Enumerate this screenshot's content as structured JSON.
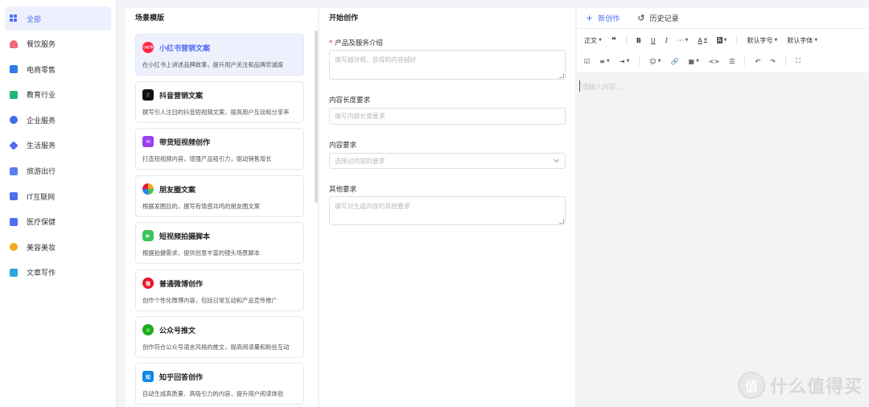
{
  "sidebar": {
    "items": [
      {
        "label": "全部",
        "color": "#4e6ef2"
      },
      {
        "label": "餐饮服务",
        "color": "#f06a7a"
      },
      {
        "label": "电商零售",
        "color": "#2f7be8"
      },
      {
        "label": "教育行业",
        "color": "#22b573"
      },
      {
        "label": "企业服务",
        "color": "#3d6ee8"
      },
      {
        "label": "生活服务",
        "color": "#4e6ef2"
      },
      {
        "label": "旅游出行",
        "color": "#5b7df0"
      },
      {
        "label": "IT互联网",
        "color": "#4e6ef2"
      },
      {
        "label": "医疗保健",
        "color": "#4e6ef2"
      },
      {
        "label": "美容美妆",
        "color": "#f5a623"
      },
      {
        "label": "文章写作",
        "color": "#2ba6e0"
      }
    ]
  },
  "scene": {
    "title": "场景模版",
    "cards": [
      {
        "title": "小红书营销文案",
        "desc": "在小红书上讲述品牌故事，提升用户关注和品牌忠诚度",
        "icon": "xiaohongshu-icon",
        "icon_text": "小红书",
        "color": "#ff2442"
      },
      {
        "title": "抖音营销文案",
        "desc": "撰写引人注目的抖音短视频文案，提高用户互动和分享率",
        "icon": "douyin-icon",
        "icon_text": "♪",
        "color": "#111111"
      },
      {
        "title": "带货短视频创作",
        "desc": "打造短视频内容，增强产品吸引力，驱动销售增长",
        "icon": "mail-icon",
        "icon_text": "✉",
        "color": "#9b3ff0"
      },
      {
        "title": "朋友圈文案",
        "desc": "根据发圈目的，撰写有情感共鸣的朋友圈文案",
        "icon": "moments-icon",
        "icon_text": "",
        "color": "#f5a623"
      },
      {
        "title": "短视频拍摄脚本",
        "desc": "根据拍摄需求，提供创意丰富的镜头场景脚本",
        "icon": "video-camera-icon",
        "icon_text": "▶",
        "color": "#3cc55a"
      },
      {
        "title": "普通微博创作",
        "desc": "创作个性化微博内容，包括日常互动和产品宣传推广",
        "icon": "weibo-icon",
        "icon_text": "微",
        "color": "#e6162d"
      },
      {
        "title": "公众号推文",
        "desc": "创作符合公众号语言风格的推文，提高阅读量和粉丝互动",
        "icon": "wechat-official-icon",
        "icon_text": "◎",
        "color": "#1aad19"
      },
      {
        "title": "知乎回答创作",
        "desc": "自动生成高质量、高吸引力的内容，提升用户阅读体验",
        "icon": "zhihu-icon",
        "icon_text": "知",
        "color": "#0f88eb"
      }
    ]
  },
  "form": {
    "title": "开始创作",
    "fields": [
      {
        "label": "产品及服务介绍",
        "required": true,
        "placeholder": "填写越详细，获得的内容越好"
      },
      {
        "label": "内容长度要求",
        "required": false,
        "placeholder": "填写内容长度要求"
      },
      {
        "label": "内容要求",
        "required": false,
        "placeholder": "选择对内容的要求"
      },
      {
        "label": "其他要求",
        "required": false,
        "placeholder": "填写对生成内容的其他要求"
      }
    ]
  },
  "editor": {
    "tab_new": "新创作",
    "tab_history": "历史记录",
    "toolbar": {
      "paragraph": "正文",
      "font_size": "默认字号",
      "font_family": "默认字体"
    },
    "placeholder": "请输入内容..."
  },
  "watermark": {
    "logo_text": "值",
    "text": "什么值得买"
  }
}
